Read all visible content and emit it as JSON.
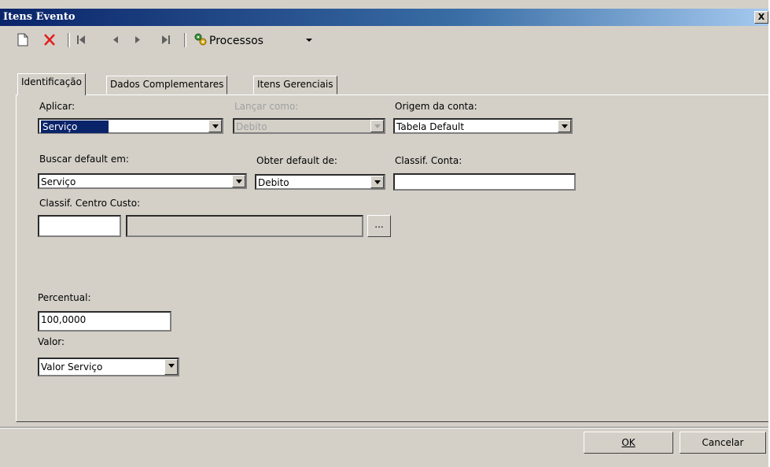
{
  "window": {
    "title": "Itens Evento",
    "close": "X"
  },
  "toolbar": {
    "processos_label": "Processos"
  },
  "tabs": [
    {
      "label": "Identificação"
    },
    {
      "label": "Dados Complementares"
    },
    {
      "label": "Itens Gerenciais"
    }
  ],
  "form": {
    "aplicar": {
      "label": "Aplicar:",
      "value": "Serviço"
    },
    "lancar": {
      "label": "Lançar como:",
      "value": "Debito"
    },
    "origem": {
      "label": "Origem da conta:",
      "value": "Tabela Default"
    },
    "buscar": {
      "label": "Buscar default em:",
      "value": "Serviço"
    },
    "obter": {
      "label": "Obter default de:",
      "value": "Debito"
    },
    "classif_conta": {
      "label": "Classif. Conta:",
      "value": ""
    },
    "classif_cc": {
      "label": "Classif. Centro Custo:",
      "code": "",
      "desc": "",
      "browse": "..."
    },
    "percentual": {
      "label": "Percentual:",
      "value": "100,0000"
    },
    "valor": {
      "label": "Valor:",
      "value": "Valor Serviço"
    }
  },
  "buttons": {
    "ok": "OK",
    "cancelar": "Cancelar"
  }
}
